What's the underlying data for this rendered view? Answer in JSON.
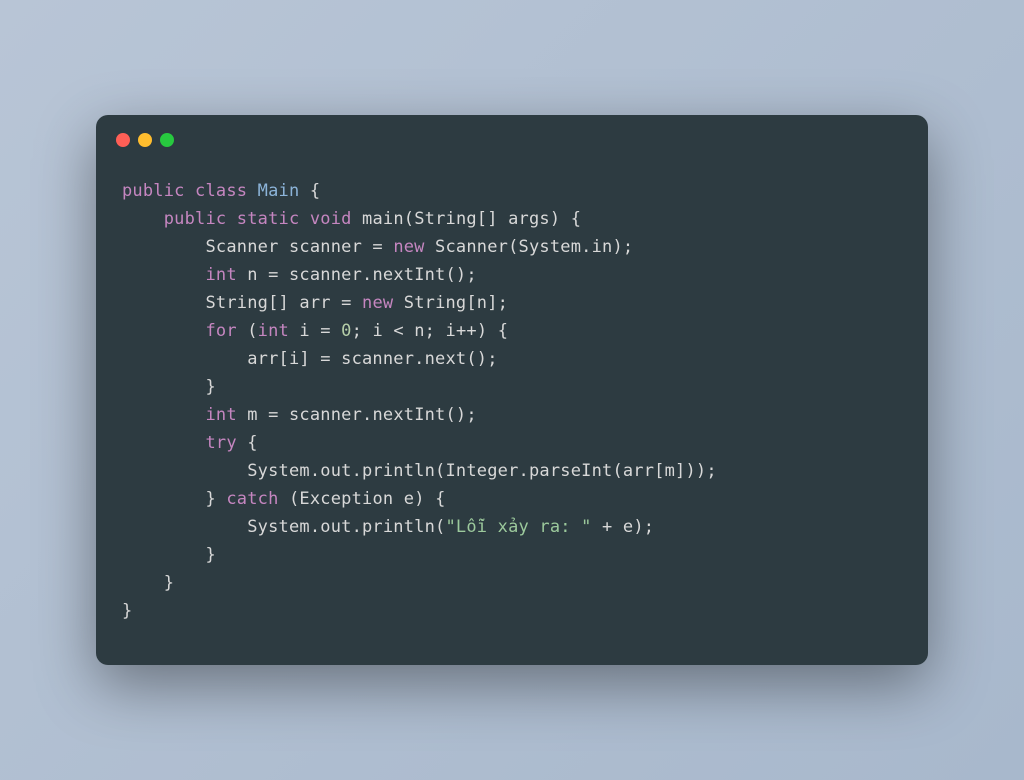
{
  "window": {
    "traffic_lights": [
      "red",
      "yellow",
      "green"
    ]
  },
  "code": {
    "tokens": [
      [
        {
          "class": "kw",
          "text": "public"
        },
        {
          "class": "plain",
          "text": " "
        },
        {
          "class": "kw",
          "text": "class"
        },
        {
          "class": "plain",
          "text": " "
        },
        {
          "class": "classname",
          "text": "Main"
        },
        {
          "class": "plain",
          "text": " {"
        }
      ],
      [
        {
          "class": "plain",
          "text": "    "
        },
        {
          "class": "kw",
          "text": "public"
        },
        {
          "class": "plain",
          "text": " "
        },
        {
          "class": "kw",
          "text": "static"
        },
        {
          "class": "plain",
          "text": " "
        },
        {
          "class": "type",
          "text": "void"
        },
        {
          "class": "plain",
          "text": " main(String[] args) {"
        }
      ],
      [
        {
          "class": "plain",
          "text": "        Scanner scanner = "
        },
        {
          "class": "kw",
          "text": "new"
        },
        {
          "class": "plain",
          "text": " Scanner(System.in);"
        }
      ],
      [
        {
          "class": "plain",
          "text": "        "
        },
        {
          "class": "type",
          "text": "int"
        },
        {
          "class": "plain",
          "text": " n = scanner.nextInt();"
        }
      ],
      [
        {
          "class": "plain",
          "text": "        String[] arr = "
        },
        {
          "class": "kw",
          "text": "new"
        },
        {
          "class": "plain",
          "text": " String[n];"
        }
      ],
      [
        {
          "class": "plain",
          "text": "        "
        },
        {
          "class": "kw",
          "text": "for"
        },
        {
          "class": "plain",
          "text": " ("
        },
        {
          "class": "type",
          "text": "int"
        },
        {
          "class": "plain",
          "text": " i = "
        },
        {
          "class": "num",
          "text": "0"
        },
        {
          "class": "plain",
          "text": "; i < n; i++) {"
        }
      ],
      [
        {
          "class": "plain",
          "text": "            arr[i] = scanner.next();"
        }
      ],
      [
        {
          "class": "plain",
          "text": "        }"
        }
      ],
      [
        {
          "class": "plain",
          "text": "        "
        },
        {
          "class": "type",
          "text": "int"
        },
        {
          "class": "plain",
          "text": " m = scanner.nextInt();"
        }
      ],
      [
        {
          "class": "plain",
          "text": "        "
        },
        {
          "class": "kw",
          "text": "try"
        },
        {
          "class": "plain",
          "text": " {"
        }
      ],
      [
        {
          "class": "plain",
          "text": "            System.out.println(Integer.parseInt(arr[m]));"
        }
      ],
      [
        {
          "class": "plain",
          "text": "        } "
        },
        {
          "class": "kw",
          "text": "catch"
        },
        {
          "class": "plain",
          "text": " (Exception e) {"
        }
      ],
      [
        {
          "class": "plain",
          "text": "            System.out.println("
        },
        {
          "class": "str",
          "text": "\"Lỗi xảy ra: \""
        },
        {
          "class": "plain",
          "text": " + e);"
        }
      ],
      [
        {
          "class": "plain",
          "text": "        }"
        }
      ],
      [
        {
          "class": "plain",
          "text": "    }"
        }
      ],
      [
        {
          "class": "plain",
          "text": "}"
        }
      ]
    ]
  }
}
